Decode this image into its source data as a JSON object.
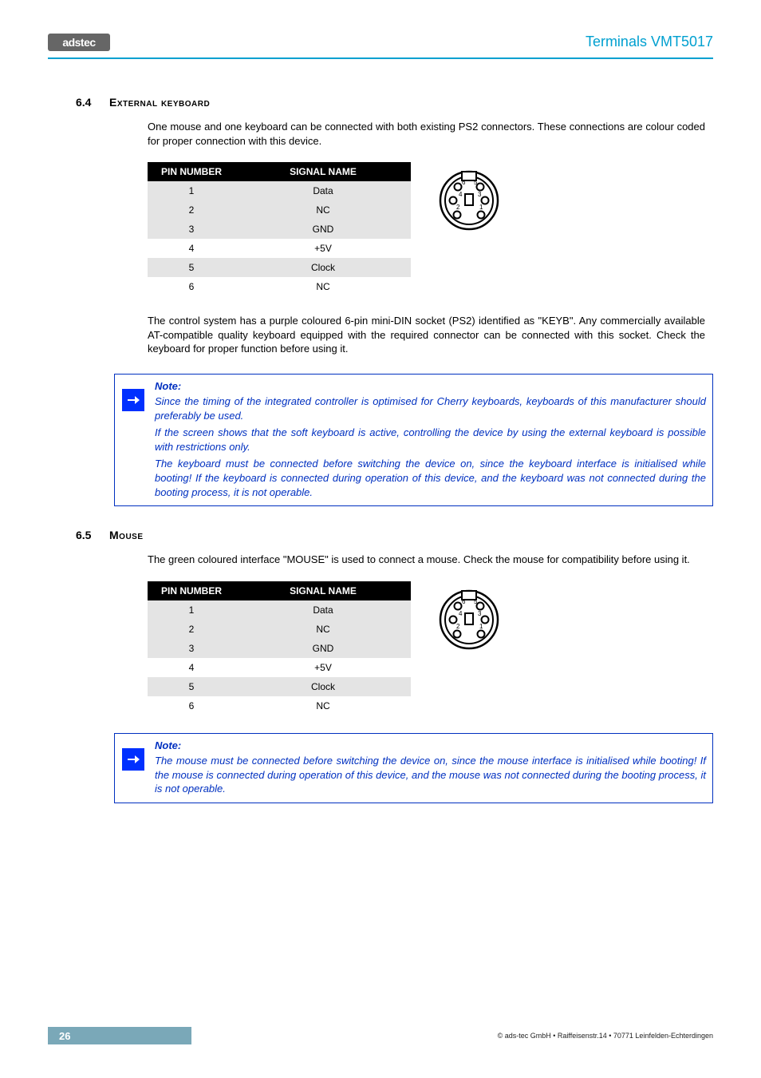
{
  "header": {
    "logo_text": "adstec",
    "doc_title": "Terminals VMT5017"
  },
  "section_kbd": {
    "number": "6.4",
    "title": "External keyboard",
    "intro": "One mouse and one keyboard can be connected with both existing PS2 connectors. These connections are colour coded for proper connection with this device.",
    "table": {
      "head_pin": "PIN NUMBER",
      "head_sig": "SIGNAL NAME",
      "rows": [
        {
          "pin": "1",
          "sig": "Data"
        },
        {
          "pin": "2",
          "sig": "NC"
        },
        {
          "pin": "3",
          "sig": "GND"
        },
        {
          "pin": "4",
          "sig": "+5V"
        },
        {
          "pin": "5",
          "sig": "Clock"
        },
        {
          "pin": "6",
          "sig": "NC"
        }
      ]
    },
    "after": "The control system has a purple coloured 6-pin mini-DIN socket (PS2) identified as \"KEYB\". Any commercially available AT-compatible quality keyboard equipped with the required connector can be connected with this socket. Check the keyboard for proper function before using it.",
    "note": {
      "heading": "Note:",
      "p1": "Since the timing of the integrated controller is optimised for Cherry keyboards, keyboards of this manufacturer should preferably be used.",
      "p2": "If the screen shows that the soft keyboard is active, controlling the device by using the external keyboard is possible with restrictions only.",
      "p3": "The keyboard must be connected before switching the device on, since the keyboard interface is initialised while booting! If the keyboard is connected during operation of this device, and the keyboard was not connected during the booting process, it is not operable."
    }
  },
  "section_mouse": {
    "number": "6.5",
    "title": "Mouse",
    "intro": "The green coloured interface \"MOUSE\" is used to connect a mouse. Check the mouse for compatibility before using it.",
    "table": {
      "head_pin": "PIN NUMBER",
      "head_sig": "SIGNAL NAME",
      "rows": [
        {
          "pin": "1",
          "sig": "Data"
        },
        {
          "pin": "2",
          "sig": "NC"
        },
        {
          "pin": "3",
          "sig": "GND"
        },
        {
          "pin": "4",
          "sig": "+5V"
        },
        {
          "pin": "5",
          "sig": "Clock"
        },
        {
          "pin": "6",
          "sig": "NC"
        }
      ]
    },
    "note": {
      "heading": "Note:",
      "p1": "The mouse must be connected before switching the device on, since the mouse interface is initialised while booting! If the mouse is connected during operation of this device, and the mouse was not connected during the booting process, it is not operable."
    }
  },
  "footer": {
    "page": "26",
    "copyright": "© ads-tec GmbH • Raiffeisenstr.14 • 70771 Leinfelden-Echterdingen"
  }
}
